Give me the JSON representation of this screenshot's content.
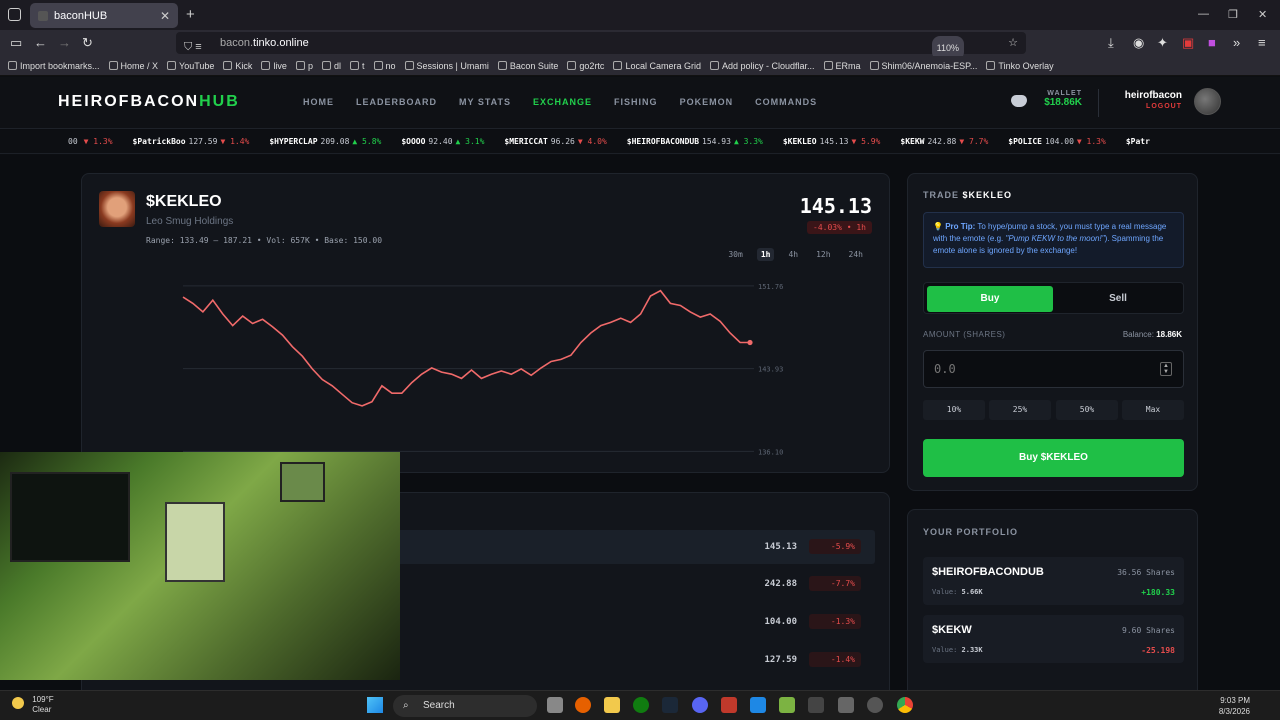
{
  "browser": {
    "tab_title": "baconHUB",
    "url_prefix": "bacon.",
    "url_host": "tinko.online",
    "zoom": "110%",
    "bookmarks": [
      "Import bookmarks...",
      "Home / X",
      "YouTube",
      "Kick",
      "live",
      "p",
      "dl",
      "t",
      "no",
      "Sessions | Umami",
      "Bacon Suite",
      "go2rtc",
      "Local Camera Grid",
      "Add policy - Cloudflar...",
      "ERma",
      "Shim06/Anemoia-ESP...",
      "Tinko Overlay"
    ]
  },
  "header": {
    "logo_main": "HEIROFBACON",
    "logo_accent": "HUB",
    "nav": [
      "HOME",
      "LEADERBOARD",
      "MY STATS",
      "EXCHANGE",
      "FISHING",
      "POKEMON",
      "COMMANDS"
    ],
    "active_nav": "EXCHANGE",
    "wallet_label": "WALLET",
    "wallet_value": "$18.86K",
    "username": "heirofbacon",
    "logout": "LOGOUT"
  },
  "ticker": [
    {
      "sym": "",
      "price": "",
      "chg": "▼ 1.3%",
      "dir": "dn",
      "pre": "00"
    },
    {
      "sym": "$PatrickBoo",
      "price": "127.59",
      "chg": "▼ 1.4%",
      "dir": "dn"
    },
    {
      "sym": "$HYPERCLAP",
      "price": "209.08",
      "chg": "▲ 5.8%",
      "dir": "up"
    },
    {
      "sym": "$OOOO",
      "price": "92.40",
      "chg": "▲ 3.1%",
      "dir": "up"
    },
    {
      "sym": "$MERICCAT",
      "price": "96.26",
      "chg": "▼ 4.0%",
      "dir": "dn"
    },
    {
      "sym": "$HEIROFBACONDUB",
      "price": "154.93",
      "chg": "▲ 3.3%",
      "dir": "up"
    },
    {
      "sym": "$KEKLEO",
      "price": "145.13",
      "chg": "▼ 5.9%",
      "dir": "dn"
    },
    {
      "sym": "$KEKW",
      "price": "242.88",
      "chg": "▼ 7.7%",
      "dir": "dn"
    },
    {
      "sym": "$POLICE",
      "price": "104.00",
      "chg": "▼ 1.3%",
      "dir": "dn"
    },
    {
      "sym": "$Patr",
      "price": "",
      "chg": "",
      "dir": "dn"
    }
  ],
  "stock": {
    "symbol": "$KEKLEO",
    "name": "Leo Smug Holdings",
    "meta": "Range: 133.49 — 187.21  •  Vol: 657K  •  Base: 150.00",
    "price": "145.13",
    "change": "-4.03% • 1h",
    "ranges": [
      "30m",
      "1h",
      "4h",
      "12h",
      "24h"
    ],
    "selected_range": "1h"
  },
  "chart_data": {
    "type": "line",
    "title": "",
    "xlabel": "",
    "ylabel": "",
    "ylim": [
      134.9,
      152.6
    ],
    "yticks": [
      151.76,
      143.93,
      136.1
    ],
    "series": [
      {
        "color": "#f06a6a",
        "values": [
          150.7,
          150.1,
          149.3,
          150.4,
          149.1,
          148.0,
          148.9,
          148.2,
          148.6,
          147.9,
          147.1,
          146.0,
          145.1,
          143.9,
          142.9,
          142.3,
          141.5,
          140.7,
          140.4,
          140.8,
          142.3,
          141.6,
          141.6,
          142.6,
          143.4,
          144.0,
          143.6,
          143.4,
          143.0,
          143.8,
          143.0,
          143.4,
          143.7,
          143.4,
          143.9,
          143.3,
          144.0,
          144.6,
          144.8,
          145.2,
          146.4,
          147.3,
          148.0,
          148.3,
          148.7,
          148.3,
          149.1,
          150.8,
          151.3,
          150.1,
          149.9,
          149.3,
          148.8,
          149.1,
          148.4,
          147.3,
          146.4,
          146.4
        ]
      }
    ]
  },
  "list_rows": [
    {
      "price": "145.13",
      "change": "-5.9%"
    },
    {
      "price": "242.88",
      "change": "-7.7%"
    },
    {
      "price": "104.00",
      "change": "-1.3%"
    },
    {
      "price": "127.59",
      "change": "-1.4%"
    }
  ],
  "trade": {
    "title_prefix": "TRADE",
    "symbol": "$KEKLEO",
    "tip_label": "Pro Tip:",
    "tip_text": "To hype/pump a stock, you must type a real message with the emote (e.g.",
    "tip_example": "\"Pump KEKW to the moon!\"",
    "tip_tail": "). Spamming the emote alone is ignored by the exchange!",
    "buy_tab": "Buy",
    "sell_tab": "Sell",
    "amount_label": "AMOUNT (SHARES)",
    "balance_label": "Balance:",
    "balance_value": "18.86K",
    "amount_placeholder": "0.0",
    "pct_buttons": [
      "10%",
      "25%",
      "50%",
      "Max"
    ],
    "buy_button": "Buy $KEKLEO"
  },
  "portfolio": {
    "title": "YOUR PORTFOLIO",
    "items": [
      {
        "symbol": "$HEIROFBACONDUB",
        "shares": "36.56 Shares",
        "value_label": "Value:",
        "value": "5.66K",
        "pl": "+180.33",
        "dir": "up"
      },
      {
        "symbol": "$KEKW",
        "shares": "9.60 Shares",
        "value_label": "Value:",
        "value": "2.33K",
        "pl": "-25.198",
        "dir": "dn"
      }
    ]
  },
  "taskbar": {
    "temp": "109°F",
    "weather": "Clear",
    "search": "Search",
    "time": "9:03 PM",
    "date": "8/3/2026"
  }
}
